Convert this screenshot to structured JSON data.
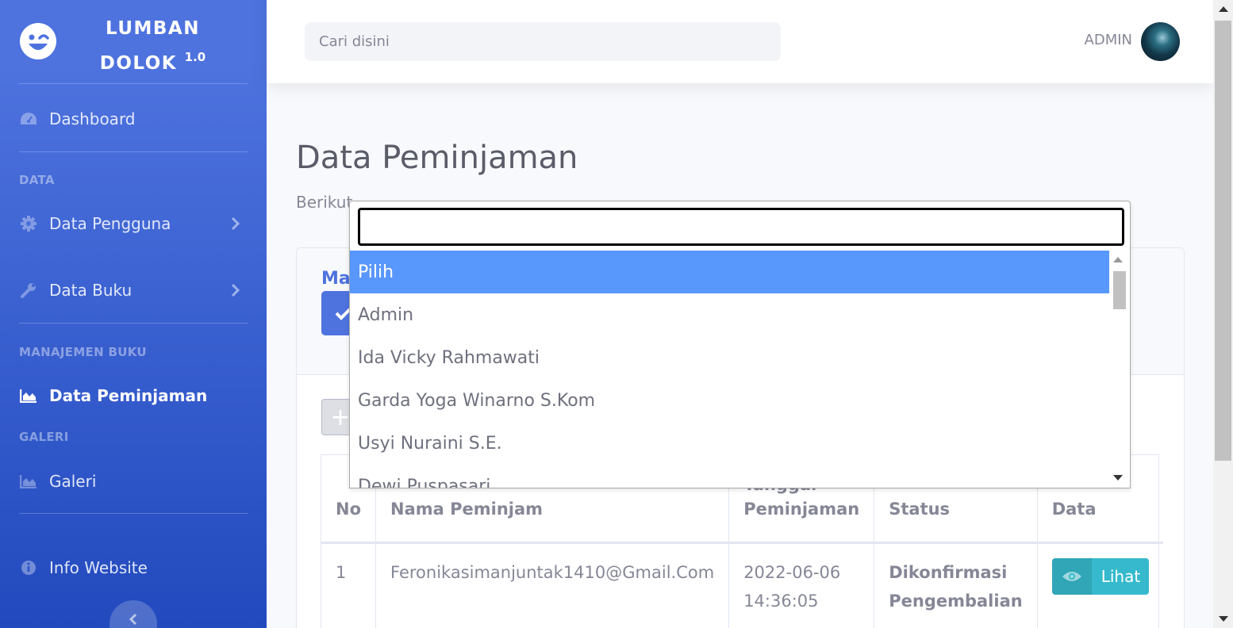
{
  "brand": {
    "line1": "LUMBAN",
    "line2": "DOLOK",
    "version": "1.0",
    "icon": "laugh-wink-icon"
  },
  "sidebar": {
    "dashboard": "Dashboard",
    "heading_data": "DATA",
    "data_pengguna": "Data Pengguna",
    "data_buku": "Data Buku",
    "heading_manajemen": "MANAJEMEN BUKU",
    "data_peminjaman": "Data Peminjaman",
    "heading_galeri": "GALERI",
    "galeri": "Galeri",
    "info_website": "Info Website"
  },
  "topbar": {
    "search_placeholder": "Cari disini",
    "user_name": "ADMIN"
  },
  "main": {
    "title": "Data Peminjaman",
    "description": "Berikut",
    "card_title": "Ma",
    "add_button": "+"
  },
  "table": {
    "headers": {
      "no": "No",
      "nama": "Nama Peminjam",
      "tanggal": "Peminjaman",
      "tanggal_partial": "Tanggal",
      "status": "Status",
      "lihat": "Lihat Data"
    },
    "rows": [
      {
        "no": "1",
        "nama": "Feronikasimanjuntak1410@Gmail.Com",
        "tanggal_date": "2022-06-06",
        "tanggal_time": "14:36:05",
        "status_1": "Dikonfirmasi",
        "status_2": "Pengembalian",
        "action": "Lihat"
      }
    ]
  },
  "dropdown": {
    "search_value": "",
    "options": [
      "Pilih",
      "Admin",
      "Ida Vicky Rahmawati",
      "Garda Yoga Winarno S.Kom",
      "Usyi Nuraini S.E.",
      "Dewi Puspasari"
    ],
    "selected": "Pilih"
  },
  "colors": {
    "primary": "#4e73df",
    "info": "#36b9cc",
    "highlight": "#5897fb"
  }
}
